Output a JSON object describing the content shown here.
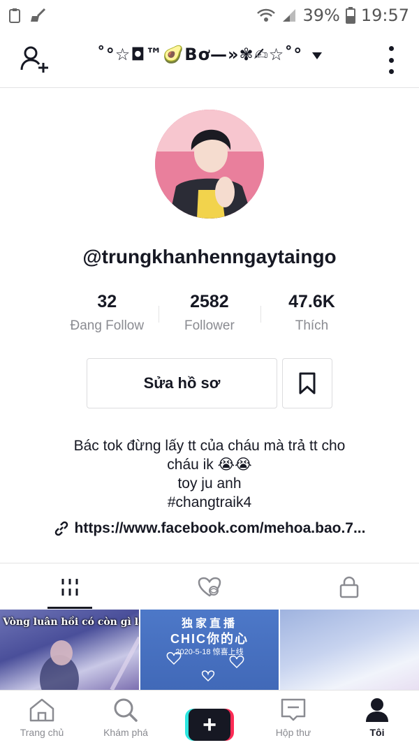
{
  "status_bar": {
    "battery": "39%",
    "time": "19:57"
  },
  "header": {
    "title": "˚°☆◘™🥑Bơ—»✾✍☆˚°",
    "icons": {
      "left": "add-user-icon",
      "right": "more-vertical-icon"
    }
  },
  "profile": {
    "username": "@trungkhanhenngaytaingo",
    "stats": [
      {
        "value": "32",
        "label": "Đang Follow"
      },
      {
        "value": "2582",
        "label": "Follower"
      },
      {
        "value": "47.6K",
        "label": "Thích"
      }
    ],
    "edit_button": "Sửa hồ sơ",
    "bio_lines": [
      "Bác tok đừng lấy tt của cháu mà trả tt cho",
      "cháu ik 😭😭",
      "toy ju anh",
      "#changtraik4"
    ],
    "link": "https://www.facebook.com/mehoa.bao.7..."
  },
  "content_tabs": [
    "grid-icon",
    "liked-hidden-icon",
    "lock-icon"
  ],
  "videos": [
    {
      "caption": "Vòng luân hồi có còn gì là đáng sợ?"
    },
    {
      "caption_lines": [
        "独家直播",
        "CHIC你的心",
        "2020-5-18  惊喜上线"
      ]
    },
    {
      "caption": ""
    }
  ],
  "bottom_nav": [
    {
      "label": "Trang chủ",
      "icon": "home-icon"
    },
    {
      "label": "Khám phá",
      "icon": "search-icon"
    },
    {
      "label": "+",
      "icon": "create-icon"
    },
    {
      "label": "Hộp thư",
      "icon": "inbox-icon"
    },
    {
      "label": "Tôi",
      "icon": "profile-icon"
    }
  ],
  "colors": {
    "text": "#161823",
    "muted": "#8a8b91",
    "accent_red": "#fe2c55",
    "accent_cyan": "#2ee6e0"
  }
}
